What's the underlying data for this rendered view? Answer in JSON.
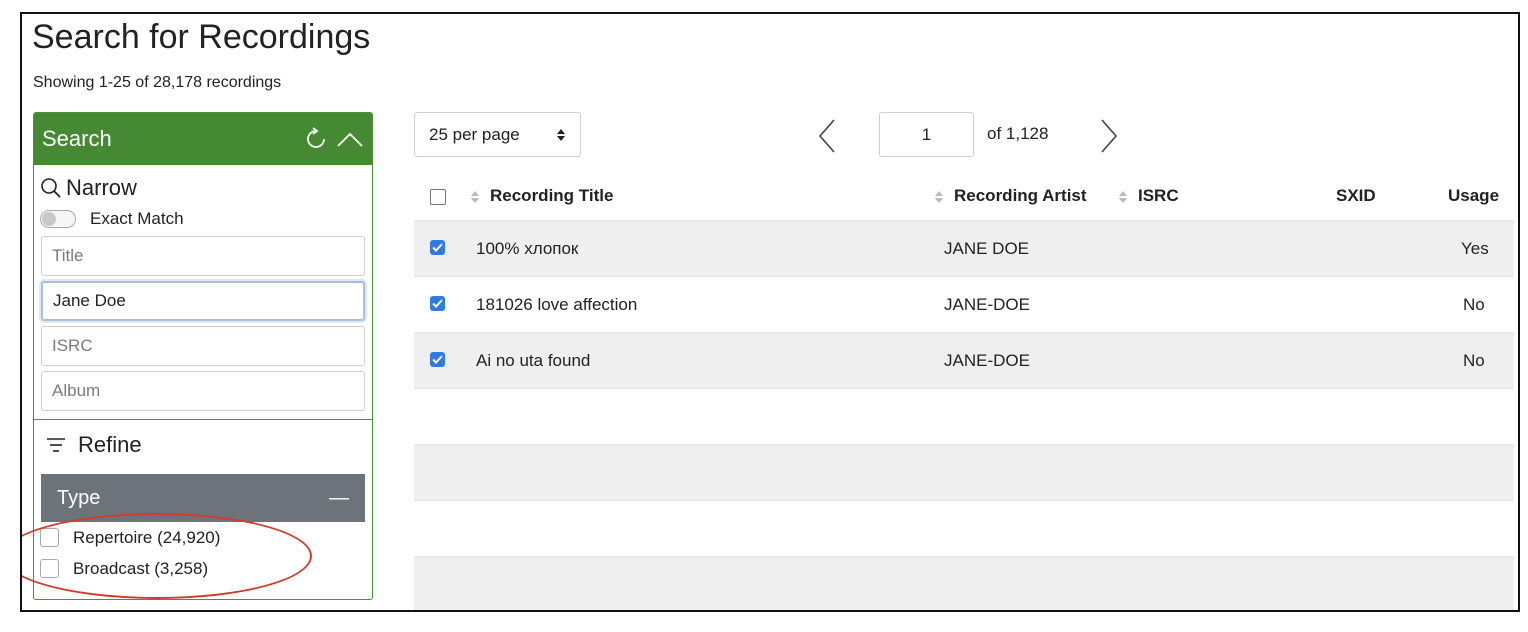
{
  "header": {
    "title": "Search for Recordings",
    "subtitle": "Showing 1-25 of 28,178 recordings"
  },
  "search_panel": {
    "title": "Search",
    "narrow_label": "Narrow",
    "exact_match_label": "Exact Match",
    "exact_match_on": false,
    "fields": {
      "title_placeholder": "Title",
      "artist_value": "Jane Doe",
      "isrc_placeholder": "ISRC",
      "album_placeholder": "Album"
    },
    "refine_label": "Refine",
    "type_header": "Type",
    "type_collapse_symbol": "—",
    "type_options": [
      {
        "label": "Repertoire (24,920)",
        "checked": false
      },
      {
        "label": "Broadcast (3,258)",
        "checked": false
      }
    ]
  },
  "pagination": {
    "per_page": "25 per page",
    "current_page": "1",
    "of_pages": "of 1,128"
  },
  "table": {
    "columns": {
      "title": "Recording Title",
      "artist": "Recording Artist",
      "isrc": "ISRC",
      "sxid": "SXID",
      "usage": "Usage"
    },
    "rows": [
      {
        "title": "100% хлопок",
        "artist": "JANE DOE",
        "isrc": "",
        "sxid": "",
        "usage": "Yes",
        "checked": true
      },
      {
        "title": "181026 love affection",
        "artist": "JANE-DOE",
        "isrc": "",
        "sxid": "",
        "usage": "No",
        "checked": true
      },
      {
        "title": "Ai no uta found",
        "artist": "JANE-DOE",
        "isrc": "",
        "sxid": "",
        "usage": "No",
        "checked": true
      }
    ]
  },
  "colors": {
    "panel_green": "#458a32",
    "type_bar_gray": "#6d737a",
    "checkbox_blue": "#2f7ae5",
    "annotation_red": "#d23a2a"
  }
}
